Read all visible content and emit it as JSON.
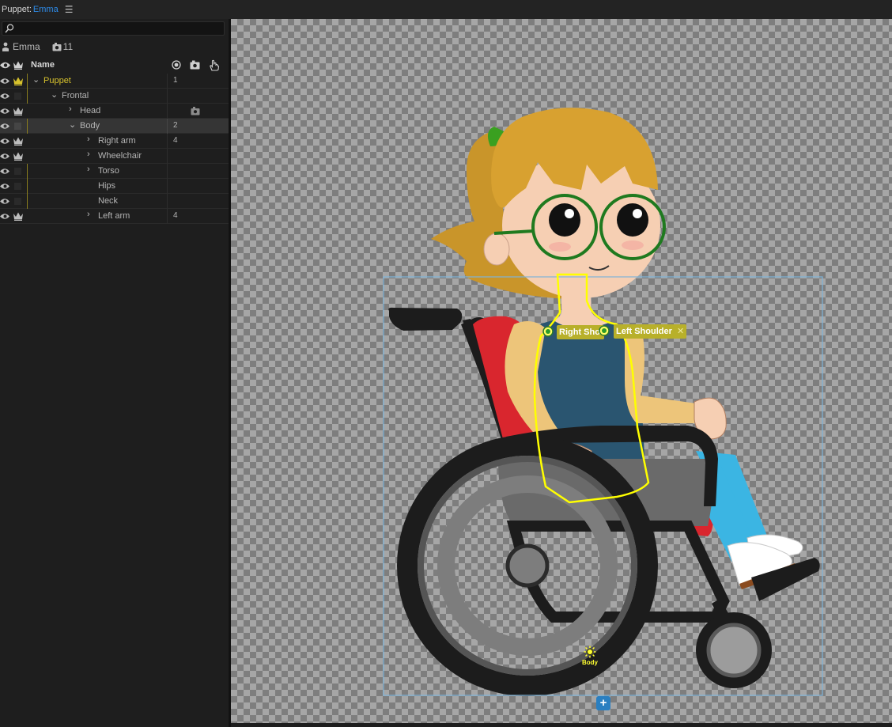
{
  "header": {
    "label": "Puppet:",
    "puppet_name": "Emma"
  },
  "panel": {
    "search_placeholder": "",
    "puppet": {
      "name": "Emma",
      "count": "11"
    },
    "columns": {
      "name": "Name"
    },
    "rows": [
      {
        "label": "Puppet",
        "num": "1"
      },
      {
        "label": "Frontal",
        "num": ""
      },
      {
        "label": "Head",
        "num": ""
      },
      {
        "label": "Body",
        "num": "2"
      },
      {
        "label": "Right arm",
        "num": "4"
      },
      {
        "label": "Wheelchair",
        "num": ""
      },
      {
        "label": "Torso",
        "num": ""
      },
      {
        "label": "Hips",
        "num": ""
      },
      {
        "label": "Neck",
        "num": ""
      },
      {
        "label": "Left arm",
        "num": "4"
      }
    ]
  },
  "canvas": {
    "handles": {
      "right_shoulder": "Right Shoulder",
      "left_shoulder": "Left Shoulder",
      "origin": "Body"
    }
  },
  "colors": {
    "accent": "#2d8ceb",
    "puppet_yellow": "#d7c22d",
    "selection": "#7fb3d8"
  }
}
